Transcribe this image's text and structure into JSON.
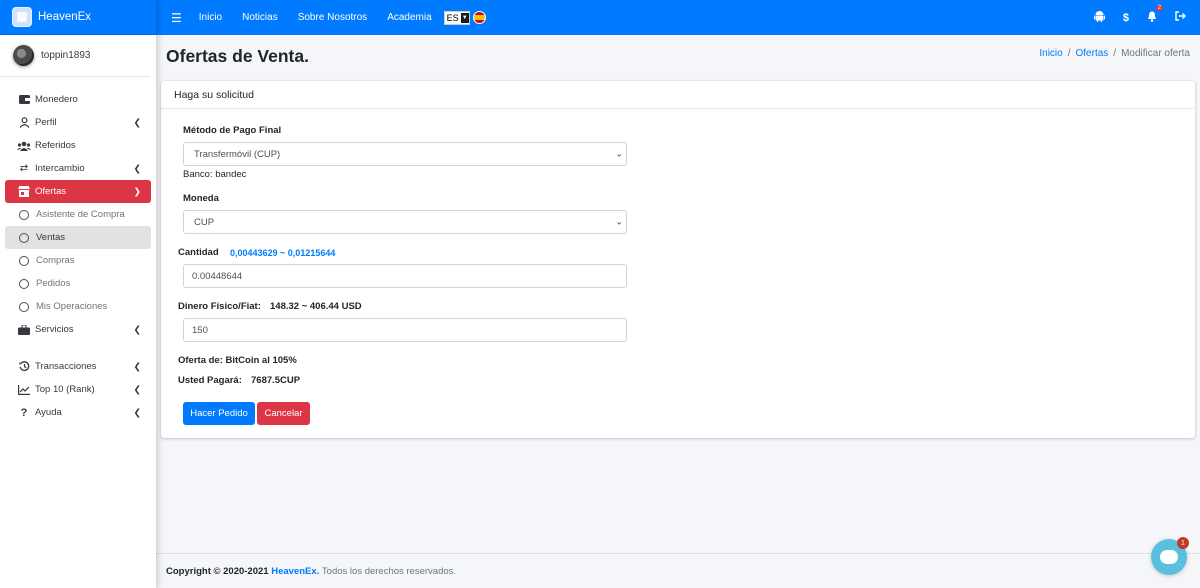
{
  "brand": {
    "name": "HeavenEx"
  },
  "user": {
    "name": "toppin1893"
  },
  "sidebar": {
    "items": [
      {
        "label": "Monedero"
      },
      {
        "label": "Perfil"
      },
      {
        "label": "Referidos"
      },
      {
        "label": "Intercambio"
      },
      {
        "label": "Ofertas"
      },
      {
        "label": "Asistente de Compra"
      },
      {
        "label": "Ventas"
      },
      {
        "label": "Compras"
      },
      {
        "label": "Pedidos"
      },
      {
        "label": "Mis Operaciones"
      },
      {
        "label": "Servicios"
      },
      {
        "label": "Transacciones"
      },
      {
        "label": "Top 10 (Rank)"
      },
      {
        "label": "Ayuda"
      }
    ]
  },
  "topbar": {
    "links": [
      "Inicio",
      "Noticias",
      "Sobre Nosotros",
      "Academia"
    ],
    "lang": "ES",
    "notification_count": "2"
  },
  "page": {
    "title": "Ofertas de Venta.",
    "breadcrumb": [
      "Inicio",
      "Ofertas",
      "Modificar oferta"
    ]
  },
  "card": {
    "header": "Haga su solicitud",
    "payment_method_label": "Método de Pago Final",
    "payment_method_value": "Transfermóvil (CUP)",
    "bank_text": "Banco: bandec",
    "currency_label": "Moneda",
    "currency_value": "CUP",
    "quantity_label": "Cantidad",
    "quantity_range": "0,00443629 ~ 0,01215644",
    "quantity_value": "0.00448644",
    "fiat_label": "Dinero Físico/Fiat:",
    "fiat_range": "148.32 ~ 406.44 USD",
    "fiat_value": "150",
    "offer_text": "Oferta de: BitCoin al 105%",
    "pay_label": "Usted Pagará:",
    "pay_value": "7687.5CUP",
    "submit_label": "Hacer Pedido",
    "cancel_label": "Cancelar"
  },
  "footer": {
    "copyright": "Copyright © 2020-2021",
    "brand": "HeavenEx.",
    "rights": "Todos los derechos reservados."
  },
  "chat": {
    "badge": "1"
  },
  "colors": {
    "primary": "#007bff",
    "danger": "#dc3545"
  }
}
